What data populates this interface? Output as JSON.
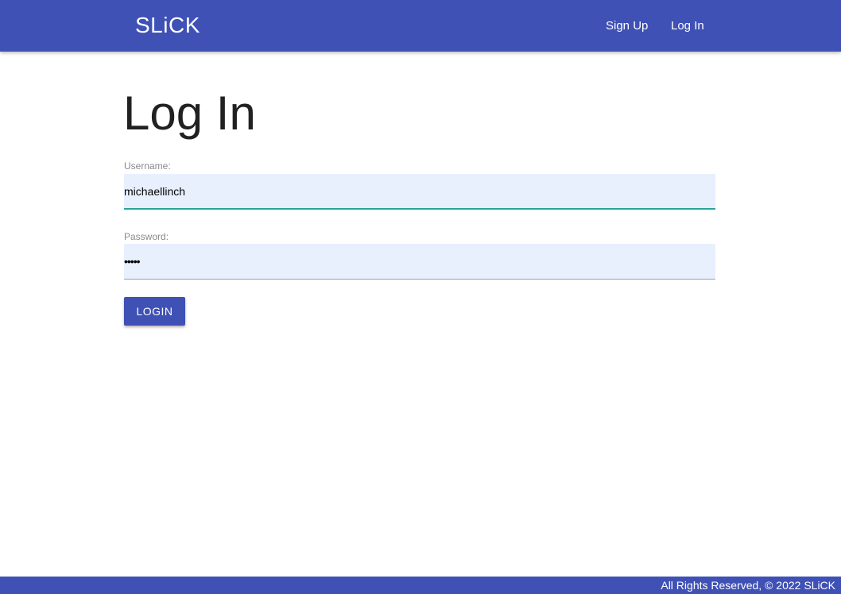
{
  "header": {
    "brand": "SLiCK",
    "nav": {
      "signup": "Sign Up",
      "login": "Log In"
    }
  },
  "main": {
    "title": "Log In",
    "username": {
      "label": "Username:",
      "value": "michaellinch"
    },
    "password": {
      "label": "Password:",
      "masked_value": "•••••"
    },
    "login_button": "LOGIN"
  },
  "footer": {
    "text": "All Rights Reserved, © 2022 SLiCK"
  },
  "colors": {
    "primary": "#3f51b5",
    "input_background": "#e8f0fe",
    "focus_underline": "#26a69a"
  }
}
